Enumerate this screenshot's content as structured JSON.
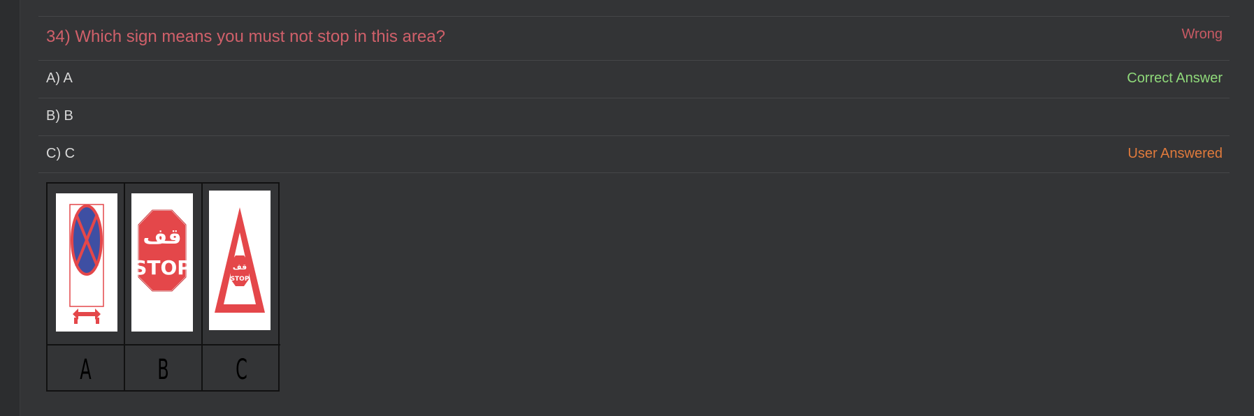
{
  "question": {
    "text": "34) Which sign means you must not stop in this area?",
    "status": "Wrong",
    "status_color": "#c85a64"
  },
  "options": [
    {
      "label": "A) A",
      "tag": "Correct Answer",
      "tag_color": "#8fd97a"
    },
    {
      "label": "B) B",
      "tag": "",
      "tag_color": ""
    },
    {
      "label": "C) C",
      "tag": "User Answered",
      "tag_color": "#e07a3c"
    }
  ],
  "figure": {
    "labels": [
      "A",
      "B",
      "C"
    ],
    "stop_text": "STOP",
    "arabic_text": "قف",
    "signs": [
      {
        "id": "A",
        "icon": "no-stopping-sign-icon"
      },
      {
        "id": "B",
        "icon": "stop-sign-icon"
      },
      {
        "id": "C",
        "icon": "stop-ahead-warning-sign-icon"
      }
    ]
  }
}
